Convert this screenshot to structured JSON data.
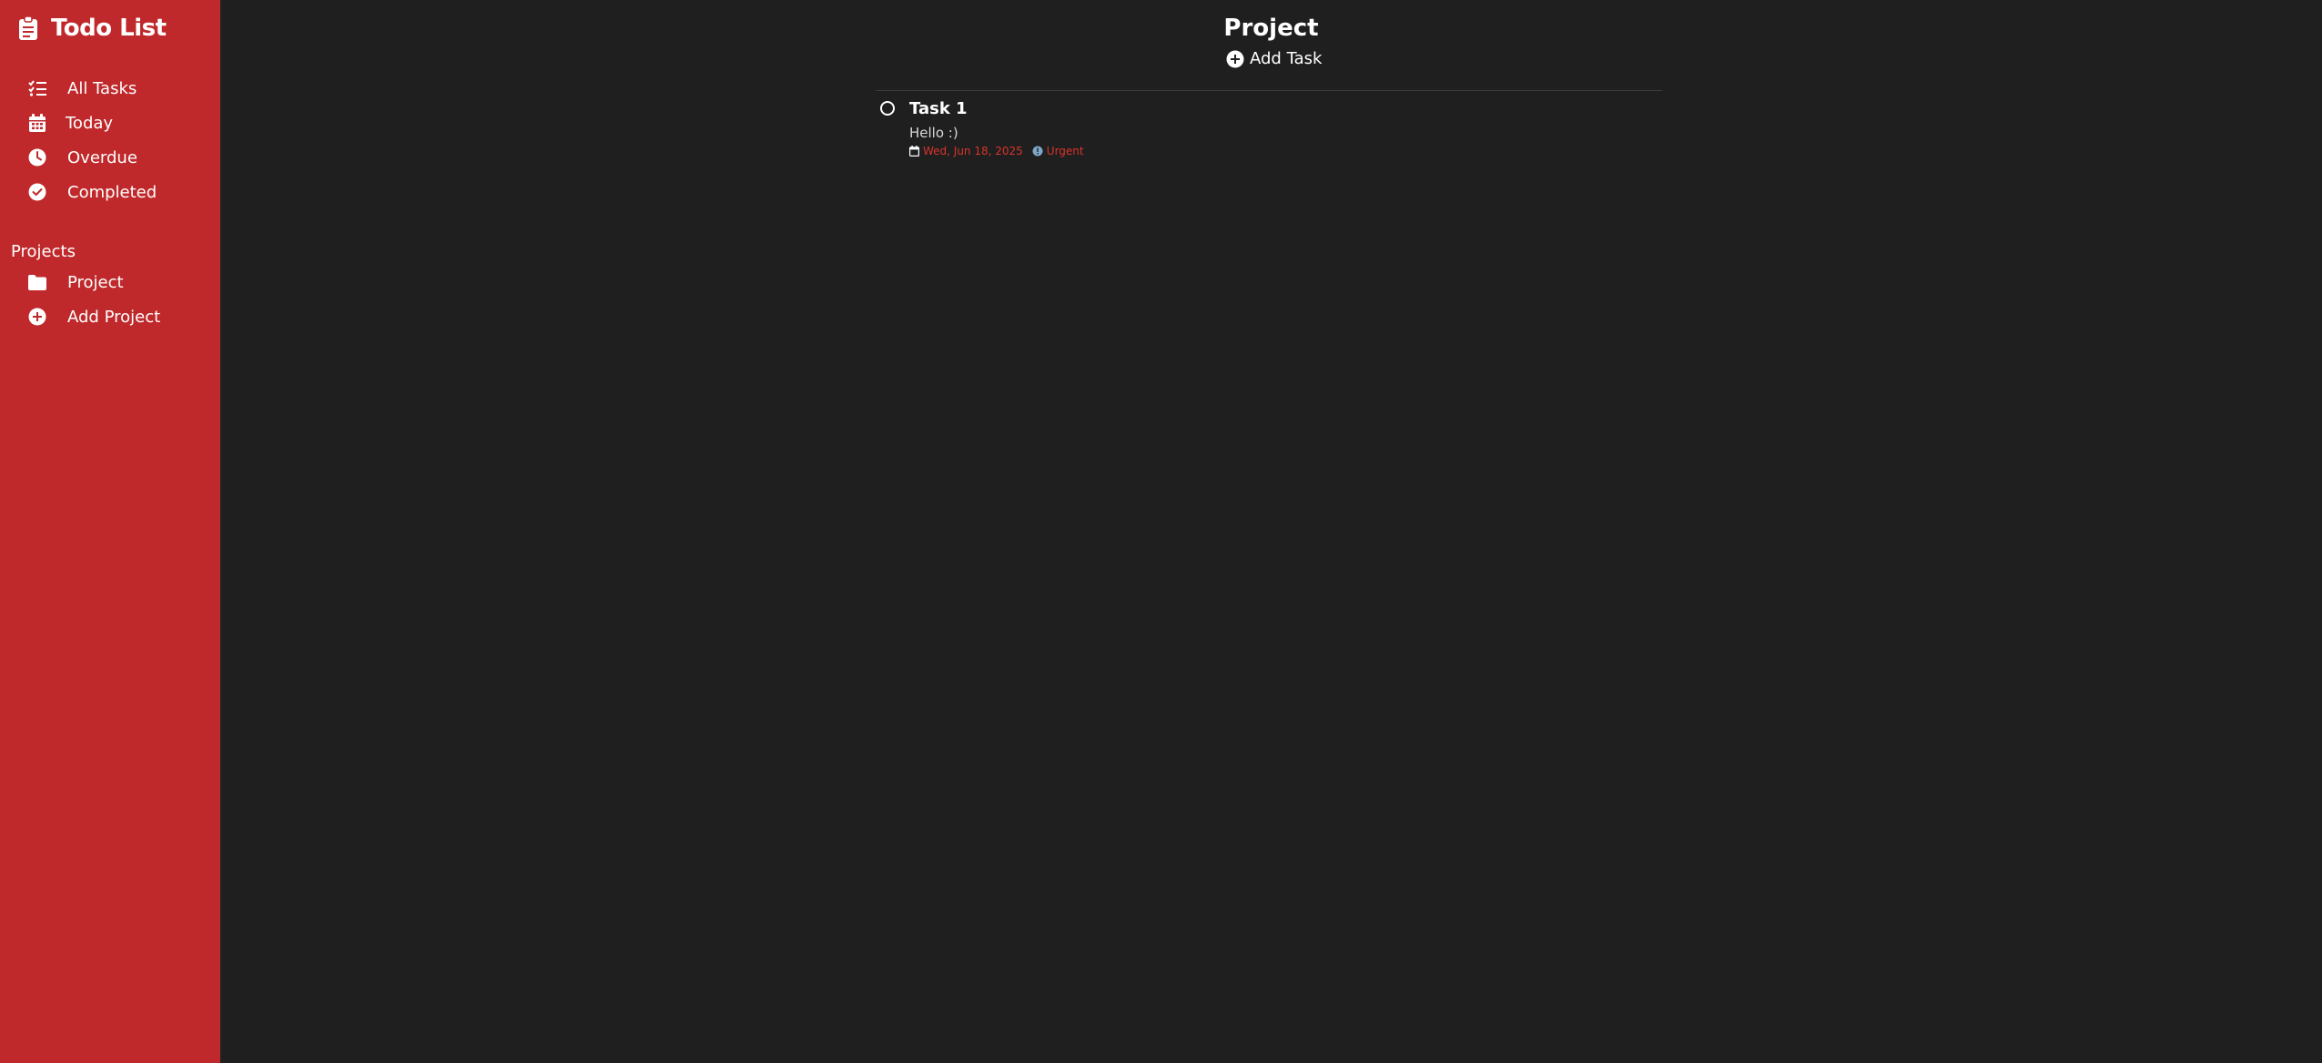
{
  "sidebar": {
    "brand": {
      "title": "Todo List",
      "icon": "clipboard-icon"
    },
    "nav": [
      {
        "label": "All Tasks",
        "icon": "list-check-icon"
      },
      {
        "label": "Today",
        "icon": "calendar-icon"
      },
      {
        "label": "Overdue",
        "icon": "clock-icon"
      },
      {
        "label": "Completed",
        "icon": "check-circle-icon"
      }
    ],
    "projects_title": "Projects",
    "projects": [
      {
        "label": "Project",
        "icon": "folder-icon"
      }
    ],
    "add_project": {
      "label": "Add Project",
      "icon": "plus-circle-icon"
    }
  },
  "main": {
    "title": "Project",
    "add_task": {
      "label": "Add Task",
      "icon": "plus-circle-icon"
    },
    "tasks": [
      {
        "title": "Task 1",
        "description": "Hello :)",
        "due_date": "Wed, Jun 18, 2025",
        "priority": "Urgent",
        "completed": false
      }
    ]
  },
  "colors": {
    "sidebar_bg": "#c0292b",
    "main_bg": "#1f1f1f",
    "text": "#ffffff",
    "urgent": "#d9342b",
    "priority_dot": "#7fa7c9"
  }
}
